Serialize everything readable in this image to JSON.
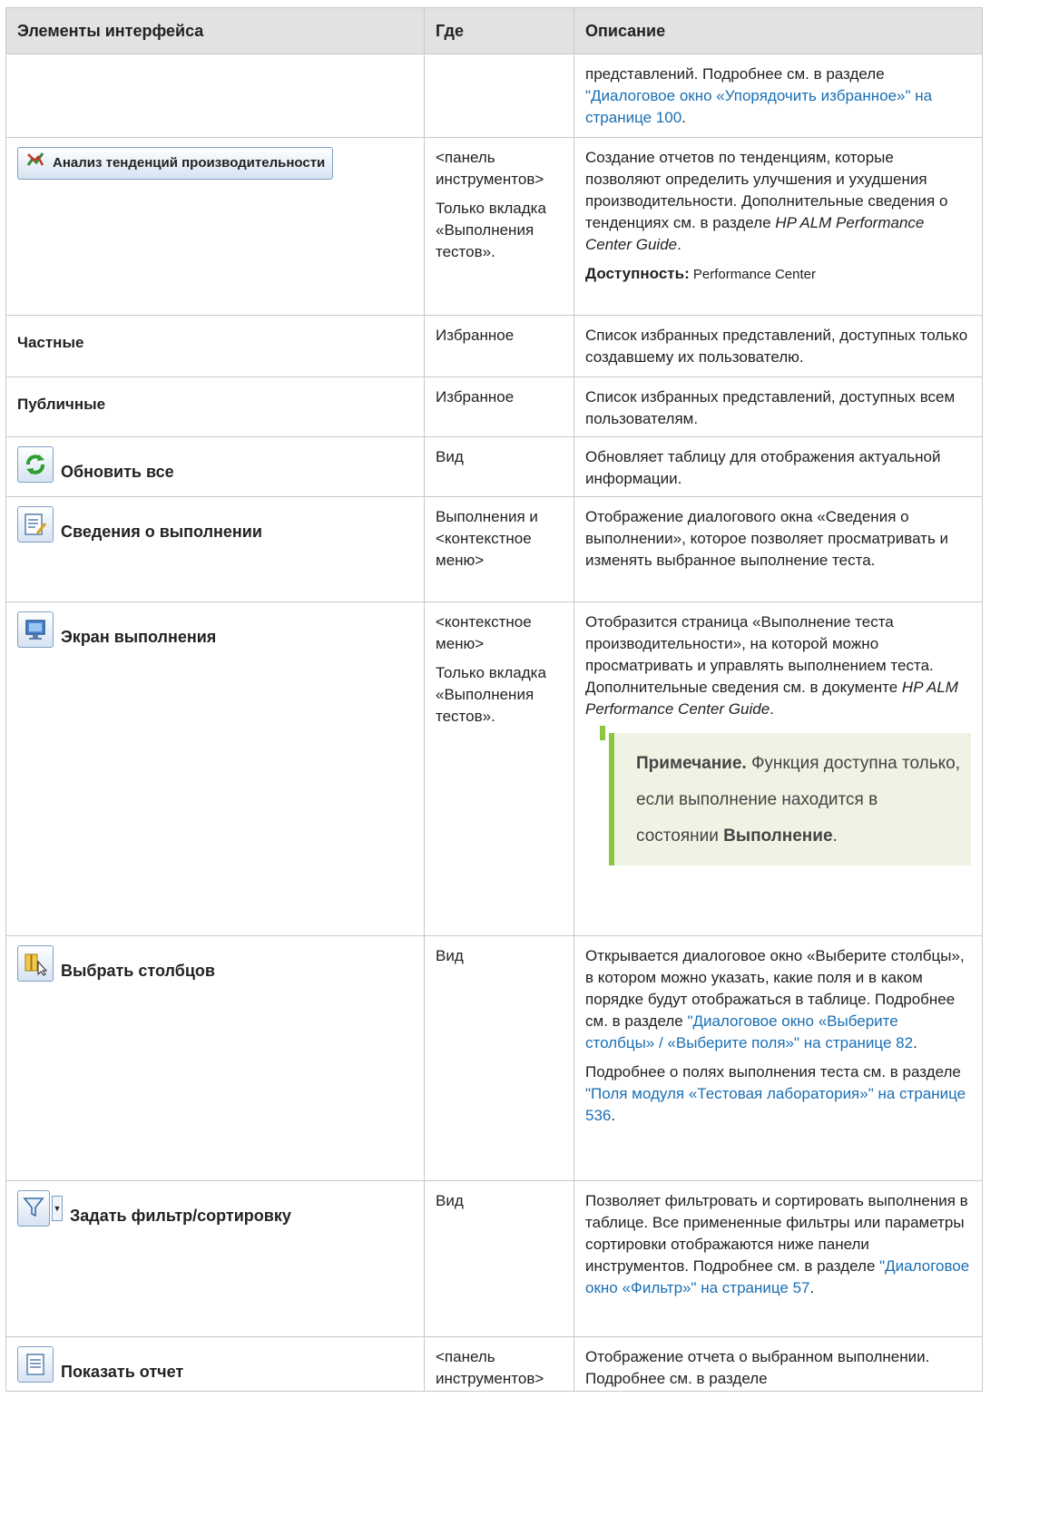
{
  "headers": {
    "col1": "Элементы интерфейса",
    "col2": "Где",
    "col3": "Описание"
  },
  "row0": {
    "desc_text": "представлений. Подробнее см. в разделе ",
    "desc_link": "\"Диалоговое окно «Упорядочить избранное»\" на странице 100",
    "desc_end": "."
  },
  "row_trend": {
    "button_label": "Анализ тенденций производительности",
    "icon": "trend-analysis-icon",
    "where1": "<панель инструментов>",
    "where2": "Только вкладка «Выполнения тестов».",
    "desc1": "Создание отчетов по тенденциям, которые позволяют определить улучшения и ухудшения производительности. Дополнительные сведения о тенденциях см. в разделе ",
    "desc1_ital": "HP ALM Performance Center Guide",
    "desc1_end": ".",
    "avail_label": "Доступность:",
    "avail_value": " Performance Center"
  },
  "row_private": {
    "label": "Частные",
    "where": "Избранное",
    "desc": "Список избранных представлений, доступных только создавшему их пользователю."
  },
  "row_public": {
    "label": "Публичные",
    "where": "Избранное",
    "desc": "Список избранных представлений, доступных всем пользователям."
  },
  "row_refresh": {
    "label": "Обновить все",
    "icon": "refresh-icon",
    "where": "Вид",
    "desc": "Обновляет таблицу для отображения актуальной информации."
  },
  "row_details": {
    "label": "Сведения о выполнении",
    "icon": "run-details-icon",
    "where": "Выполнения и <контекстное меню>",
    "desc": "Отображение диалогового окна «Сведения о выполнении», которое позволяет просматривать и изменять выбранное выполнение теста."
  },
  "row_screen": {
    "label": "Экран выполнения",
    "icon": "run-screen-icon",
    "where1": "<контекстное меню>",
    "where2": "Только вкладка «Выполнения тестов».",
    "desc": "Отобразится страница «Выполнение теста производительности», на которой можно просматривать и управлять выполнением теста. Дополнительные сведения см. в документе ",
    "desc_ital": "HP ALM Performance Center Guide",
    "desc_end": ".",
    "note_label": "Примечание.",
    "note_text": " Функция доступна только, если выполнение находится в состоянии ",
    "note_bold": "Выполнение",
    "note_end": "."
  },
  "row_columns": {
    "label": "Выбрать столбцов",
    "icon": "select-columns-icon",
    "where": "Вид",
    "desc1": "Открывается диалоговое окно «Выберите столбцы», в котором можно указать, какие поля и в каком порядке будут отображаться в таблице. Подробнее см. в разделе ",
    "desc1_link": "\"Диалоговое окно «Выберите столбцы» / «Выберите поля»\" на странице 82",
    "desc1_end": ".",
    "desc2": "Подробнее о полях выполнения теста см. в разделе ",
    "desc2_link": "\"Поля модуля «Тестовая лаборатория»\" на странице 536",
    "desc2_end": "."
  },
  "row_filter": {
    "label": "Задать фильтр/сортировку",
    "icon": "filter-icon",
    "where": "Вид",
    "desc": "Позволяет фильтровать и сортировать выполнения в таблице. Все примененные фильтры или параметры сортировки отображаются ниже панели инструментов. Подробнее см. в разделе ",
    "desc_link": "\"Диалоговое окно «Фильтр»\" на странице 57",
    "desc_end": "."
  },
  "row_report": {
    "label": "Показать отчет",
    "icon": "report-icon",
    "where": "<панель инструментов>",
    "desc": "Отображение отчета о выбранном выполнении. Подробнее см. в разделе"
  }
}
